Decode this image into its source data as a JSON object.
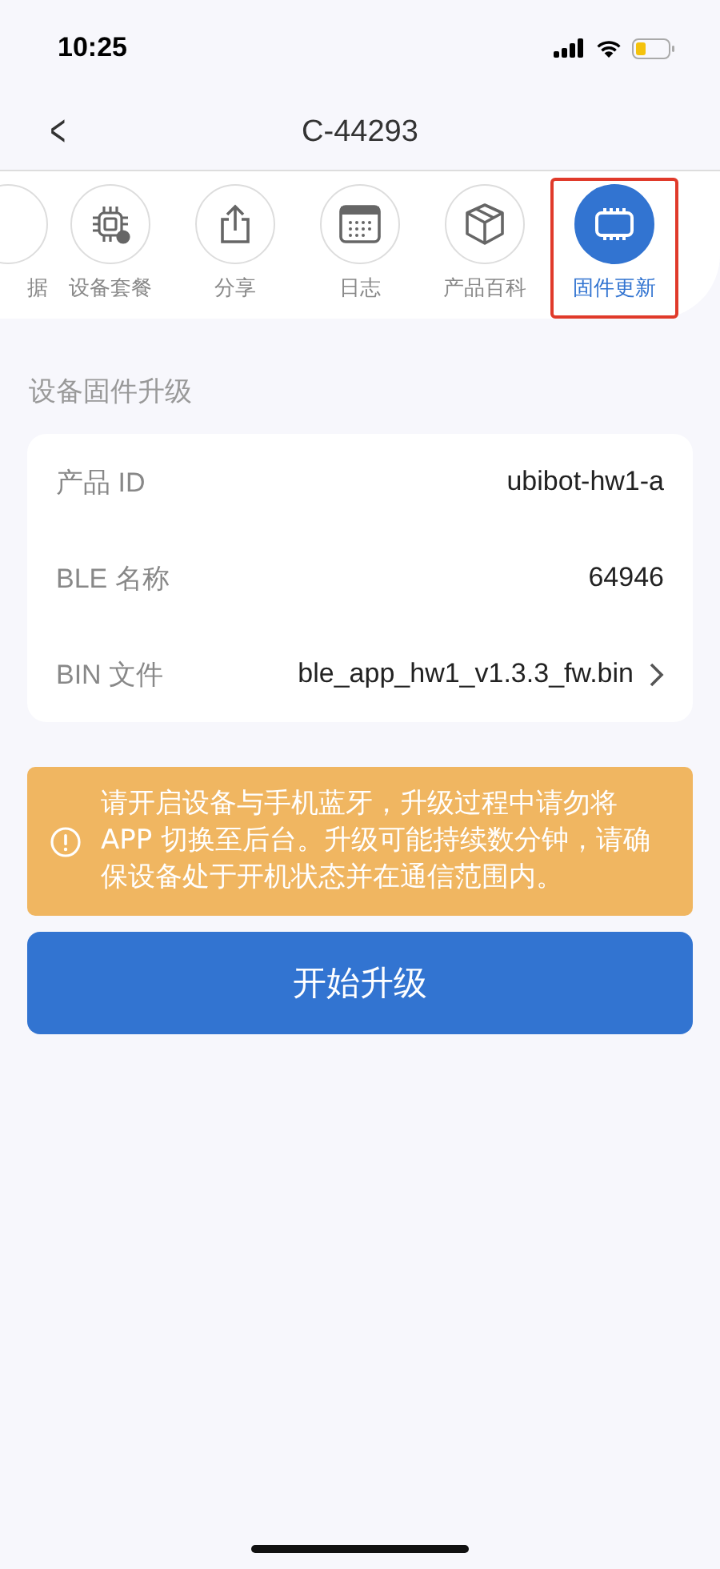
{
  "status_bar": {
    "time": "10:25"
  },
  "nav": {
    "back": "<",
    "title": "C-44293"
  },
  "tools": [
    {
      "label": "据",
      "kind": "partial",
      "selected": false
    },
    {
      "label": "设备套餐",
      "kind": "chip",
      "selected": false
    },
    {
      "label": "分享",
      "kind": "share",
      "selected": false
    },
    {
      "label": "日志",
      "kind": "calendar",
      "selected": false
    },
    {
      "label": "产品百科",
      "kind": "box",
      "selected": false
    },
    {
      "label": "固件更新",
      "kind": "firmware",
      "selected": true
    }
  ],
  "section_title": "设备固件升级",
  "fields": [
    {
      "label": "产品 ID",
      "value": "ubibot-hw1-a",
      "link": false
    },
    {
      "label": "BLE 名称",
      "value": "64946",
      "link": false
    },
    {
      "label": "BIN 文件",
      "value": "ble_app_hw1_v1.3.3_fw.bin",
      "link": true
    }
  ],
  "warning": "请开启设备与手机蓝牙，升级过程中请勿将 APP 切换至后台。升级可能持续数分钟，请确保设备处于开机状态并在通信范围内。",
  "start_button": "开始升级"
}
